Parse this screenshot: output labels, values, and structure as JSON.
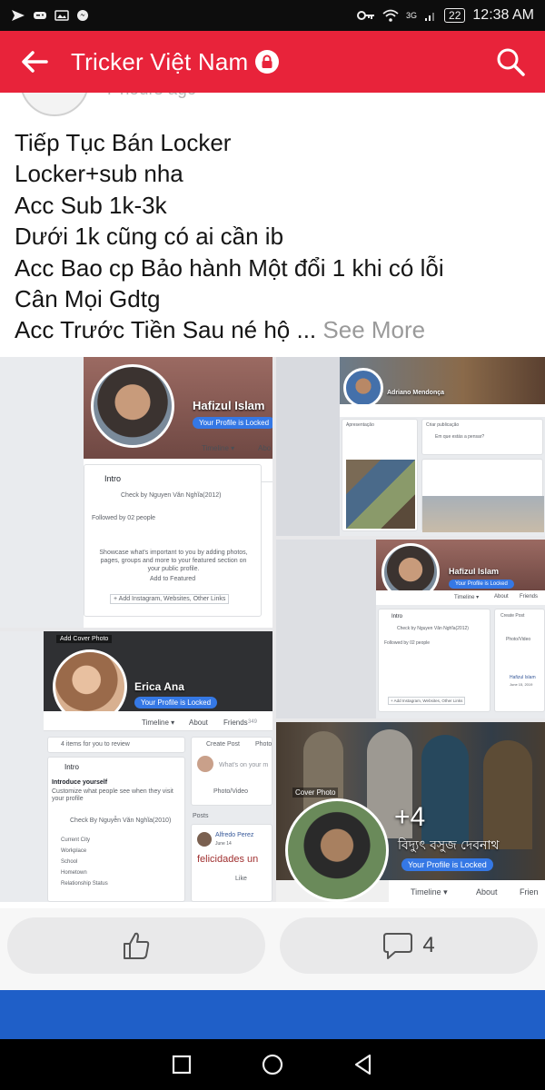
{
  "status_bar": {
    "left_icons": [
      "navigation-icon",
      "gamepad-icon",
      "image-icon",
      "messenger-icon"
    ],
    "signal_label": "3G",
    "battery": "22",
    "time": "12:38 AM"
  },
  "header": {
    "title": "Tricker Việt Nam",
    "accent_color": "#e8233a"
  },
  "post": {
    "time": "7 hours ago",
    "lines": [
      "Tiếp Tục Bán Locker",
      "Locker+sub nha",
      "Acc Sub 1k-3k",
      "Dưới 1k cũng có ai cần ib",
      "Acc Bao cp Bảo hành Một đổi 1 khi có lỗi",
      "Cân Mọi Gdtg",
      "Acc Trước Tiền Sau né hộ ..."
    ],
    "see_more": "See More"
  },
  "photos": {
    "tile1": {
      "name": "Hafizul Islam",
      "locked": "Your Profile is Locked",
      "timeline": "Timeline ▾",
      "about": "Abo",
      "intro": "Intro",
      "check": "Check by Nguyen Văn Nghĩa(2012)",
      "followed": "Followed by 02 people",
      "showcase": "Showcase what's important to you by adding photos, pages, groups and more to your featured section on your public profile.",
      "add_featured": "Add to Featured",
      "add_links": "+ Add Instagram, Websites, Other Links"
    },
    "tile2": {
      "name": "Adriano Mendonça",
      "intro": "Apresentação",
      "post": "Criar publicação",
      "placeholder": "Em que estás a pensar?"
    },
    "tile3": {
      "name": "Hafizul Islam",
      "locked": "Your Profile is Locked",
      "timeline": "Timeline ▾",
      "about": "About",
      "friends": "Friends",
      "intro": "Intro",
      "check": "Check by Nguyen Văn Nghĩa(2012)",
      "followed": "Followed by 02 people",
      "create_post": "Create Post",
      "photo_video": "Photo/Video",
      "poster": "Hafizul Islam",
      "date": "June 15, 2019",
      "add_links": "+ Add Instagram, Websites, Other Links"
    },
    "tile4": {
      "add_cover": "Add Cover Photo",
      "name": "Erica Ana",
      "locked": "Your Profile is Locked",
      "timeline": "Timeline ▾",
      "about": "About",
      "friends": "Friends",
      "friends_count": "349",
      "review": "4 items for you to review",
      "intro": "Intro",
      "introduce": "Introduce yourself",
      "customize": "Customize what people see when they visit your profile",
      "check": "Check By Nguyễn Văn Nghĩa(2010)",
      "fields": [
        "Current City",
        "Workplace",
        "School",
        "Hometown",
        "Relationship Status"
      ],
      "create_post": "Create Post",
      "photo": "Photo",
      "placeholder": "What's on your m",
      "photo_video": "Photo/Video",
      "posts": "Posts",
      "commenter": "Alfredo Perez",
      "comment_date": "June 14",
      "comment": "felicidades un",
      "like": "Like"
    },
    "tile5": {
      "cover_label": "Cover Photo",
      "name": "বিদ্যুৎ বসুজ দেবনাথ",
      "locked": "Your Profile is Locked",
      "timeline": "Timeline ▾",
      "about": "About",
      "friends": "Frien",
      "more": "+4"
    }
  },
  "actions": {
    "comment_count": "4"
  },
  "colors": {
    "fb_blue": "#3578e5",
    "bottom_band": "#1f5fc8"
  }
}
